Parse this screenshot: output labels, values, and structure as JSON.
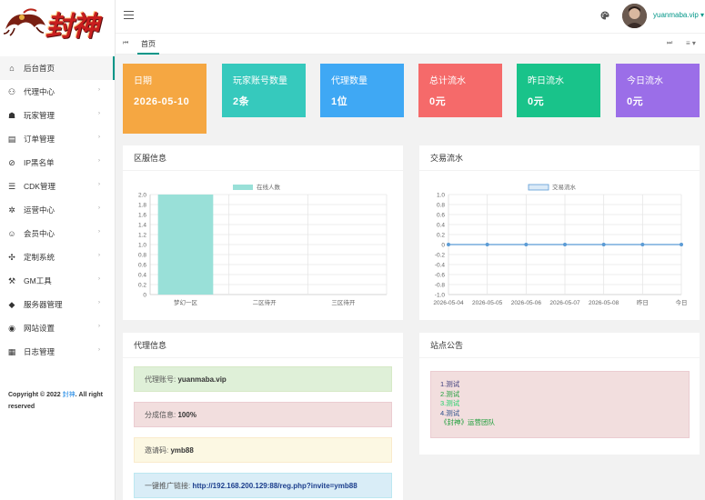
{
  "logo": {
    "text": "封神"
  },
  "sidebar": {
    "items": [
      {
        "label": "后台首页",
        "icon": "home-icon",
        "glyph": "⌂",
        "active": true,
        "has_children": false
      },
      {
        "label": "代理中心",
        "icon": "users-icon",
        "glyph": "⚇",
        "active": false,
        "has_children": true
      },
      {
        "label": "玩家管理",
        "icon": "user-group-icon",
        "glyph": "☗",
        "active": false,
        "has_children": true
      },
      {
        "label": "订单管理",
        "icon": "order-icon",
        "glyph": "▤",
        "active": false,
        "has_children": true
      },
      {
        "label": "IP黑名单",
        "icon": "blacklist-icon",
        "glyph": "⊘",
        "active": false,
        "has_children": true
      },
      {
        "label": "CDK管理",
        "icon": "list-icon",
        "glyph": "☰",
        "active": false,
        "has_children": true
      },
      {
        "label": "运营中心",
        "icon": "gear-icon",
        "glyph": "✲",
        "active": false,
        "has_children": true
      },
      {
        "label": "会员中心",
        "icon": "member-icon",
        "glyph": "☺",
        "active": false,
        "has_children": true
      },
      {
        "label": "定制系统",
        "icon": "customize-icon",
        "glyph": "✣",
        "active": false,
        "has_children": true
      },
      {
        "label": "GM工具",
        "icon": "tool-icon",
        "glyph": "⚒",
        "active": false,
        "has_children": true
      },
      {
        "label": "服务器管理",
        "icon": "diamond-icon",
        "glyph": "◆",
        "active": false,
        "has_children": true
      },
      {
        "label": "网站设置",
        "icon": "settings-icon",
        "glyph": "◉",
        "active": false,
        "has_children": true
      },
      {
        "label": "日志管理",
        "icon": "log-icon",
        "glyph": "▦",
        "active": false,
        "has_children": true
      }
    ],
    "arrow": "›",
    "copyright_prefix": "Copyright © 2022 ",
    "copyright_brand": "封神",
    "copyright_suffix": ". All right reserved"
  },
  "header": {
    "username": "yuanmaba.vip ▾"
  },
  "tabs": {
    "prev": "⏮",
    "home": "首页",
    "next": "⏭",
    "menu": "≡ ▾"
  },
  "stats": [
    {
      "title": "日期",
      "value": "2026-05-10",
      "color": "#f5a742"
    },
    {
      "title": "玩家账号数量",
      "value": "2条",
      "color": "#36c9bd"
    },
    {
      "title": "代理数量",
      "value": "1位",
      "color": "#3fa8f4"
    },
    {
      "title": "总计流水",
      "value": "0元",
      "color": "#f56a6a"
    },
    {
      "title": "昨日流水",
      "value": "0元",
      "color": "#19c38a"
    },
    {
      "title": "今日流水",
      "value": "0元",
      "color": "#9b6ee8"
    }
  ],
  "server_panel": {
    "title": "区服信息"
  },
  "trade_panel": {
    "title": "交易流水"
  },
  "agent_panel": {
    "title": "代理信息",
    "account_label": "代理账号:",
    "account_value": "yuanmaba.vip",
    "share_label": "分成信息:",
    "share_value": "100%",
    "invite_label": "邀请码:",
    "invite_value": "ymb88",
    "link_label": "一键推广链接:",
    "link_value": "http://192.168.200.129:88/reg.php?invite=ymb88"
  },
  "notice_panel": {
    "title": "站点公告",
    "lines": [
      {
        "text": "1.测试",
        "color": "#3a3a7a"
      },
      {
        "text": "2.测试",
        "color": "#1e9e3a"
      },
      {
        "text": "3.测试",
        "color": "#22d06a"
      },
      {
        "text": "4.测试",
        "color": "#2c4f8a"
      },
      {
        "text": "《封神》运营团队",
        "color": "#1e9e3a"
      }
    ]
  },
  "chart_data": [
    {
      "type": "bar",
      "title": "",
      "categories": [
        "梦幻一区",
        "二区待开",
        "三区待开"
      ],
      "series": [
        {
          "name": "在线人数",
          "values": [
            2,
            0,
            0
          ],
          "color": "#99e0d8"
        }
      ],
      "ylim": [
        0,
        2.0
      ],
      "yticks": [
        "0",
        "0.2",
        "0.4",
        "0.6",
        "0.8",
        "1.0",
        "1.2",
        "1.4",
        "1.6",
        "1.8",
        "2.0"
      ],
      "legend": "top-center",
      "grid": true
    },
    {
      "type": "line",
      "title": "",
      "categories": [
        "2026-05-04",
        "2026-05-05",
        "2026-05-06",
        "2026-05-07",
        "2026-05-08",
        "昨日",
        "今日"
      ],
      "series": [
        {
          "name": "交易流水",
          "values": [
            0,
            0,
            0,
            0,
            0,
            0,
            0
          ],
          "color": "#5b9bd5"
        }
      ],
      "ylim": [
        -1.0,
        1.0
      ],
      "yticks": [
        "-1.0",
        "-0.8",
        "-0.6",
        "-0.4",
        "-0.2",
        "0",
        "0.2",
        "0.4",
        "0.6",
        "0.8",
        "1.0"
      ],
      "legend": "top-center",
      "grid": true
    }
  ]
}
